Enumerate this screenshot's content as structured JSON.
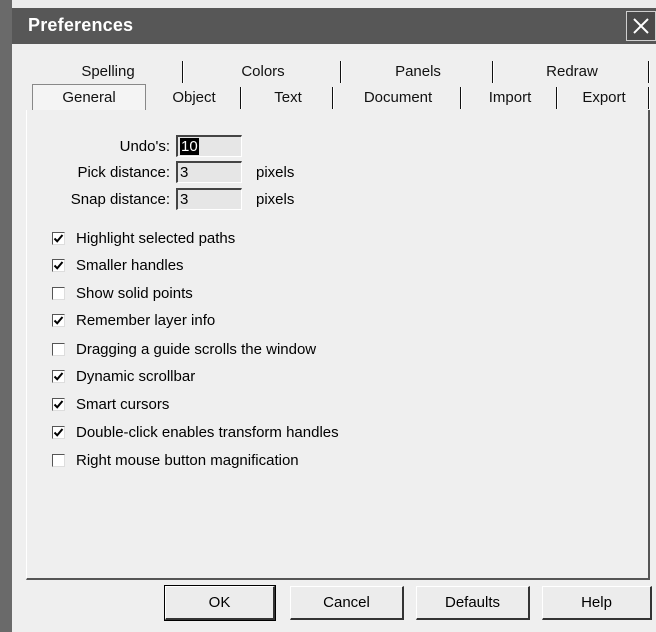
{
  "window": {
    "title": "Preferences"
  },
  "tabs": {
    "back_row": [
      "Spelling",
      "Colors",
      "Panels",
      "Redraw"
    ],
    "front_row": [
      "General",
      "Object",
      "Text",
      "Document",
      "Import",
      "Export"
    ],
    "active": "General"
  },
  "fields": [
    {
      "label": "Undo's:",
      "value": "10",
      "unit": "",
      "selected": true
    },
    {
      "label": "Pick distance:",
      "value": "3",
      "unit": "pixels",
      "selected": false
    },
    {
      "label": "Snap distance:",
      "value": "3",
      "unit": "pixels",
      "selected": false
    }
  ],
  "options": [
    {
      "label": "Highlight selected paths",
      "checked": true
    },
    {
      "label": "Smaller handles",
      "checked": true
    },
    {
      "label": "Show solid points",
      "checked": false
    },
    {
      "label": "Remember layer info",
      "checked": true
    },
    {
      "label": "Dragging a guide scrolls the window",
      "checked": false
    },
    {
      "label": "Dynamic scrollbar",
      "checked": true
    },
    {
      "label": "Smart cursors",
      "checked": true
    },
    {
      "label": "Double-click enables transform handles",
      "checked": true
    },
    {
      "label": "Right mouse button magnification",
      "checked": false
    }
  ],
  "buttons": {
    "ok": "OK",
    "cancel": "Cancel",
    "defaults": "Defaults",
    "help": "Help"
  },
  "icons": {
    "close": "close-icon",
    "check": "check-mark-icon"
  }
}
